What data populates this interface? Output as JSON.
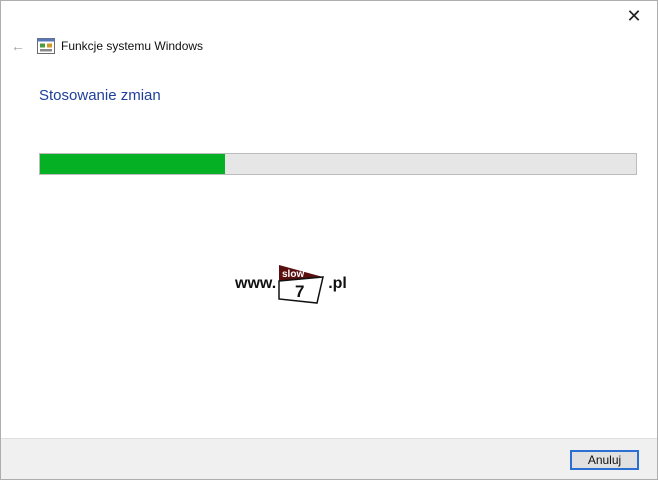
{
  "window": {
    "title": "Funkcje systemu Windows"
  },
  "icons": {
    "back": "arrow-left-icon",
    "close": "close-icon",
    "app": "windows-features-icon"
  },
  "main": {
    "status_title": "Stosowanie zmian",
    "progress": {
      "fraction": 0.31,
      "fill_color": "#06b025",
      "track_color": "#e6e6e6"
    }
  },
  "watermark": {
    "prefix": "www.",
    "logo_top": "slow",
    "logo_bottom": "7",
    "suffix": ".pl"
  },
  "footer": {
    "cancel_label": "Anuluj"
  },
  "colors": {
    "accent": "#1e3f9a",
    "focus_border": "#2a6fd1"
  }
}
